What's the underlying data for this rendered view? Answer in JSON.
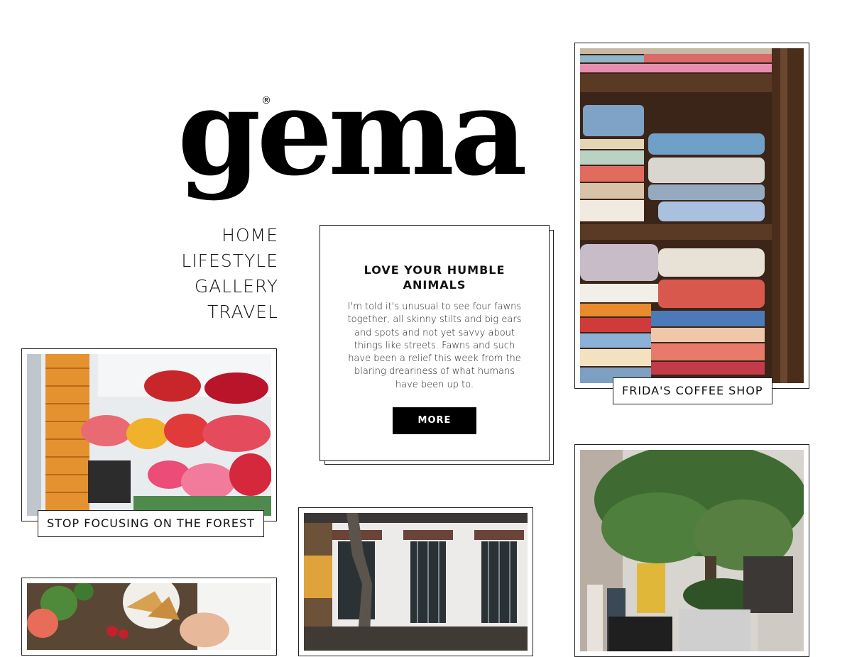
{
  "brand": {
    "logo_text": "gema",
    "registered_mark": "®"
  },
  "nav": {
    "items": [
      "HOME",
      "LIFESTYLE",
      "GALLERY",
      "TRAVEL"
    ]
  },
  "feature": {
    "title": "LOVE YOUR HUMBLE ANIMALS",
    "body": "I'm told it's unusual to see four fawns together, all skinny stilts and big ears and spots and not yet savvy about things like streets. Fawns and such have been a relief this week from the blaring dreariness of what humans have been up to.",
    "button_label": "MORE"
  },
  "posts": {
    "coffee_shop": {
      "caption": "FRIDA'S COFFEE SHOP"
    },
    "forest": {
      "caption": "STOP FOCUSING ON THE FOREST"
    }
  },
  "colors": {
    "ink": "#111111",
    "background": "#ffffff",
    "button": "#000000"
  }
}
